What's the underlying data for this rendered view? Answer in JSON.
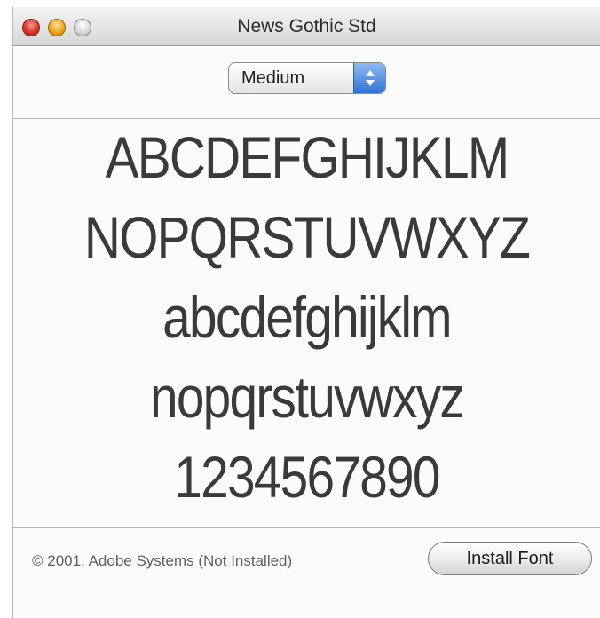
{
  "window": {
    "title": "News Gothic Std"
  },
  "style_select": {
    "selected": "Medium"
  },
  "preview": {
    "lines": [
      "ABCDEFGHIJKLM",
      "NOPQRSTUVWXYZ",
      "abcdefghijklm",
      "nopqrstuvwxyz",
      "1234567890"
    ]
  },
  "footer": {
    "status": "© 2001, Adobe Systems (Not Installed)",
    "install_label": "Install Font"
  }
}
